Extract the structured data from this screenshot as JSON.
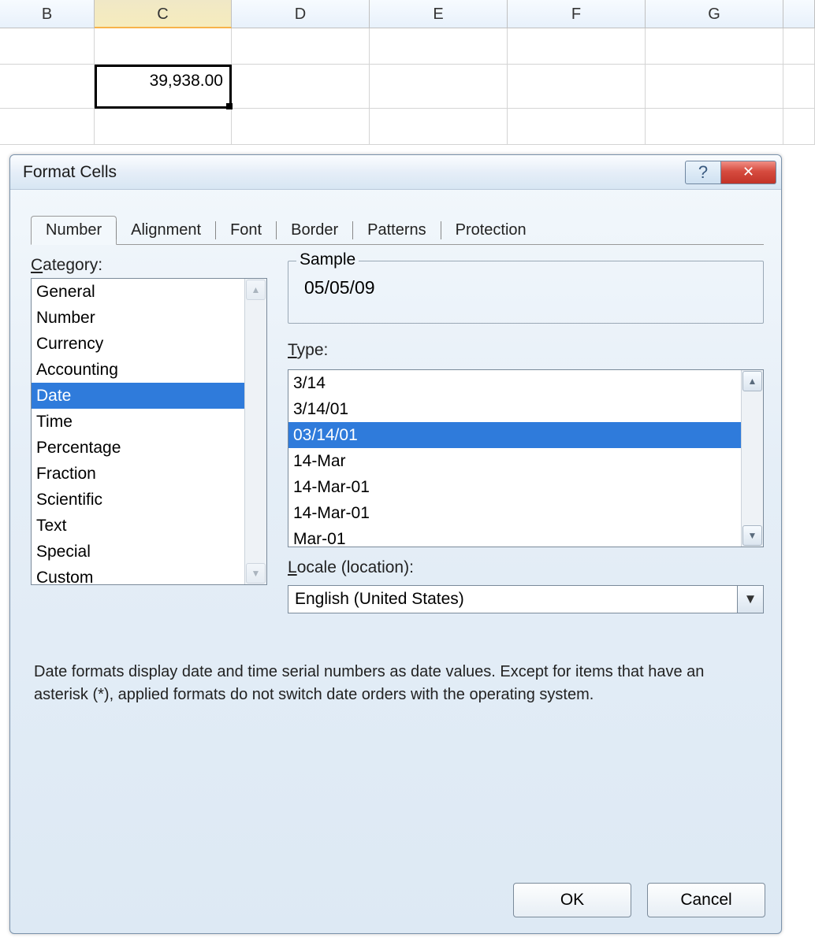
{
  "spreadsheet": {
    "columns": [
      "B",
      "C",
      "D",
      "E",
      "F",
      "G"
    ],
    "selected_column_index": 1,
    "cell_value": "39,938.00"
  },
  "dialog": {
    "title": "Format Cells",
    "tabs": [
      "Number",
      "Alignment",
      "Font",
      "Border",
      "Patterns",
      "Protection"
    ],
    "active_tab_index": 0,
    "category_label": "Category:",
    "category_underline_char": "C",
    "categories": [
      "General",
      "Number",
      "Currency",
      "Accounting",
      "Date",
      "Time",
      "Percentage",
      "Fraction",
      "Scientific",
      "Text",
      "Special",
      "Custom"
    ],
    "selected_category_index": 4,
    "sample_label": "Sample",
    "sample_value": "05/05/09",
    "type_label": "Type:",
    "type_underline_char": "T",
    "types": [
      "3/14",
      "3/14/01",
      "03/14/01",
      "14-Mar",
      "14-Mar-01",
      "14-Mar-01",
      "Mar-01"
    ],
    "selected_type_index": 2,
    "locale_label": "Locale (location):",
    "locale_underline_char": "L",
    "locale_value": "English (United States)",
    "description": "Date formats display date and time serial numbers as date values. Except for items that have an asterisk (*), applied formats do not switch date orders with the operating system.",
    "ok_label": "OK",
    "cancel_label": "Cancel"
  }
}
